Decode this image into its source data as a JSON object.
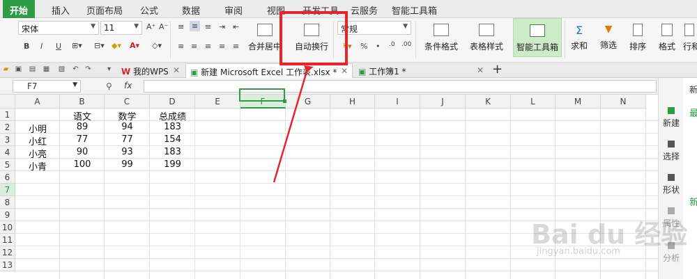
{
  "menu": {
    "tabs": [
      "开始",
      "插入",
      "页面布局",
      "公式",
      "数据",
      "审阅",
      "视图",
      "开发工具",
      "云服务",
      "智能工具箱"
    ]
  },
  "ribbon": {
    "font_name": "宋体",
    "font_size": "11",
    "number_format": "常规",
    "merge_center": "合并居中",
    "wrap_text": "自动换行",
    "conditional_format": "条件格式",
    "table_style": "表格样式",
    "smart_toolbox": "智能工具箱",
    "sum": "求和",
    "filter": "筛选",
    "sort": "排序",
    "format": "格式",
    "rows_cols": "行和",
    "percent_symbol": "%",
    "comma_symbol": "•",
    "bold": "B",
    "italic": "I",
    "underline": "U"
  },
  "documents": {
    "tabs": [
      {
        "label": "我的WPS"
      },
      {
        "label": "新建 Microsoft Excel 工作表.xlsx *"
      },
      {
        "label": "工作簿1 *"
      }
    ],
    "new_tab": "+"
  },
  "formula_bar": {
    "name_box": "F7",
    "fx_label": "fx"
  },
  "sheet": {
    "columns": [
      "A",
      "B",
      "C",
      "D",
      "E",
      "F",
      "G",
      "H",
      "I",
      "J",
      "K",
      "L",
      "M",
      "N"
    ],
    "rows": [
      "1",
      "2",
      "3",
      "4",
      "5",
      "6",
      "7",
      "8",
      "9",
      "10",
      "11",
      "12",
      "13"
    ],
    "cells": {
      "B1": "语文",
      "C1": "数学",
      "D1": "总成绩",
      "A2": "小明",
      "B2": "89",
      "C2": "94",
      "D2": "183",
      "A3": "小红",
      "B3": "77",
      "C3": "77",
      "D3": "154",
      "A4": "小亮",
      "B4": "90",
      "C4": "93",
      "D4": "183",
      "A5": "小青",
      "B5": "100",
      "C5": "99",
      "D5": "199"
    },
    "selected_cell": "F7"
  },
  "side_pane": {
    "items": [
      "新建",
      "选择",
      "形状",
      "属性",
      "分析"
    ],
    "panel_title": "新",
    "panel_items": [
      "最",
      "新"
    ]
  },
  "watermark": {
    "text": "Bai du 经验",
    "url_text": "jingyan.baidu.com"
  },
  "colors": {
    "accent": "#2e9c47",
    "highlight_box": "#e8232a"
  }
}
